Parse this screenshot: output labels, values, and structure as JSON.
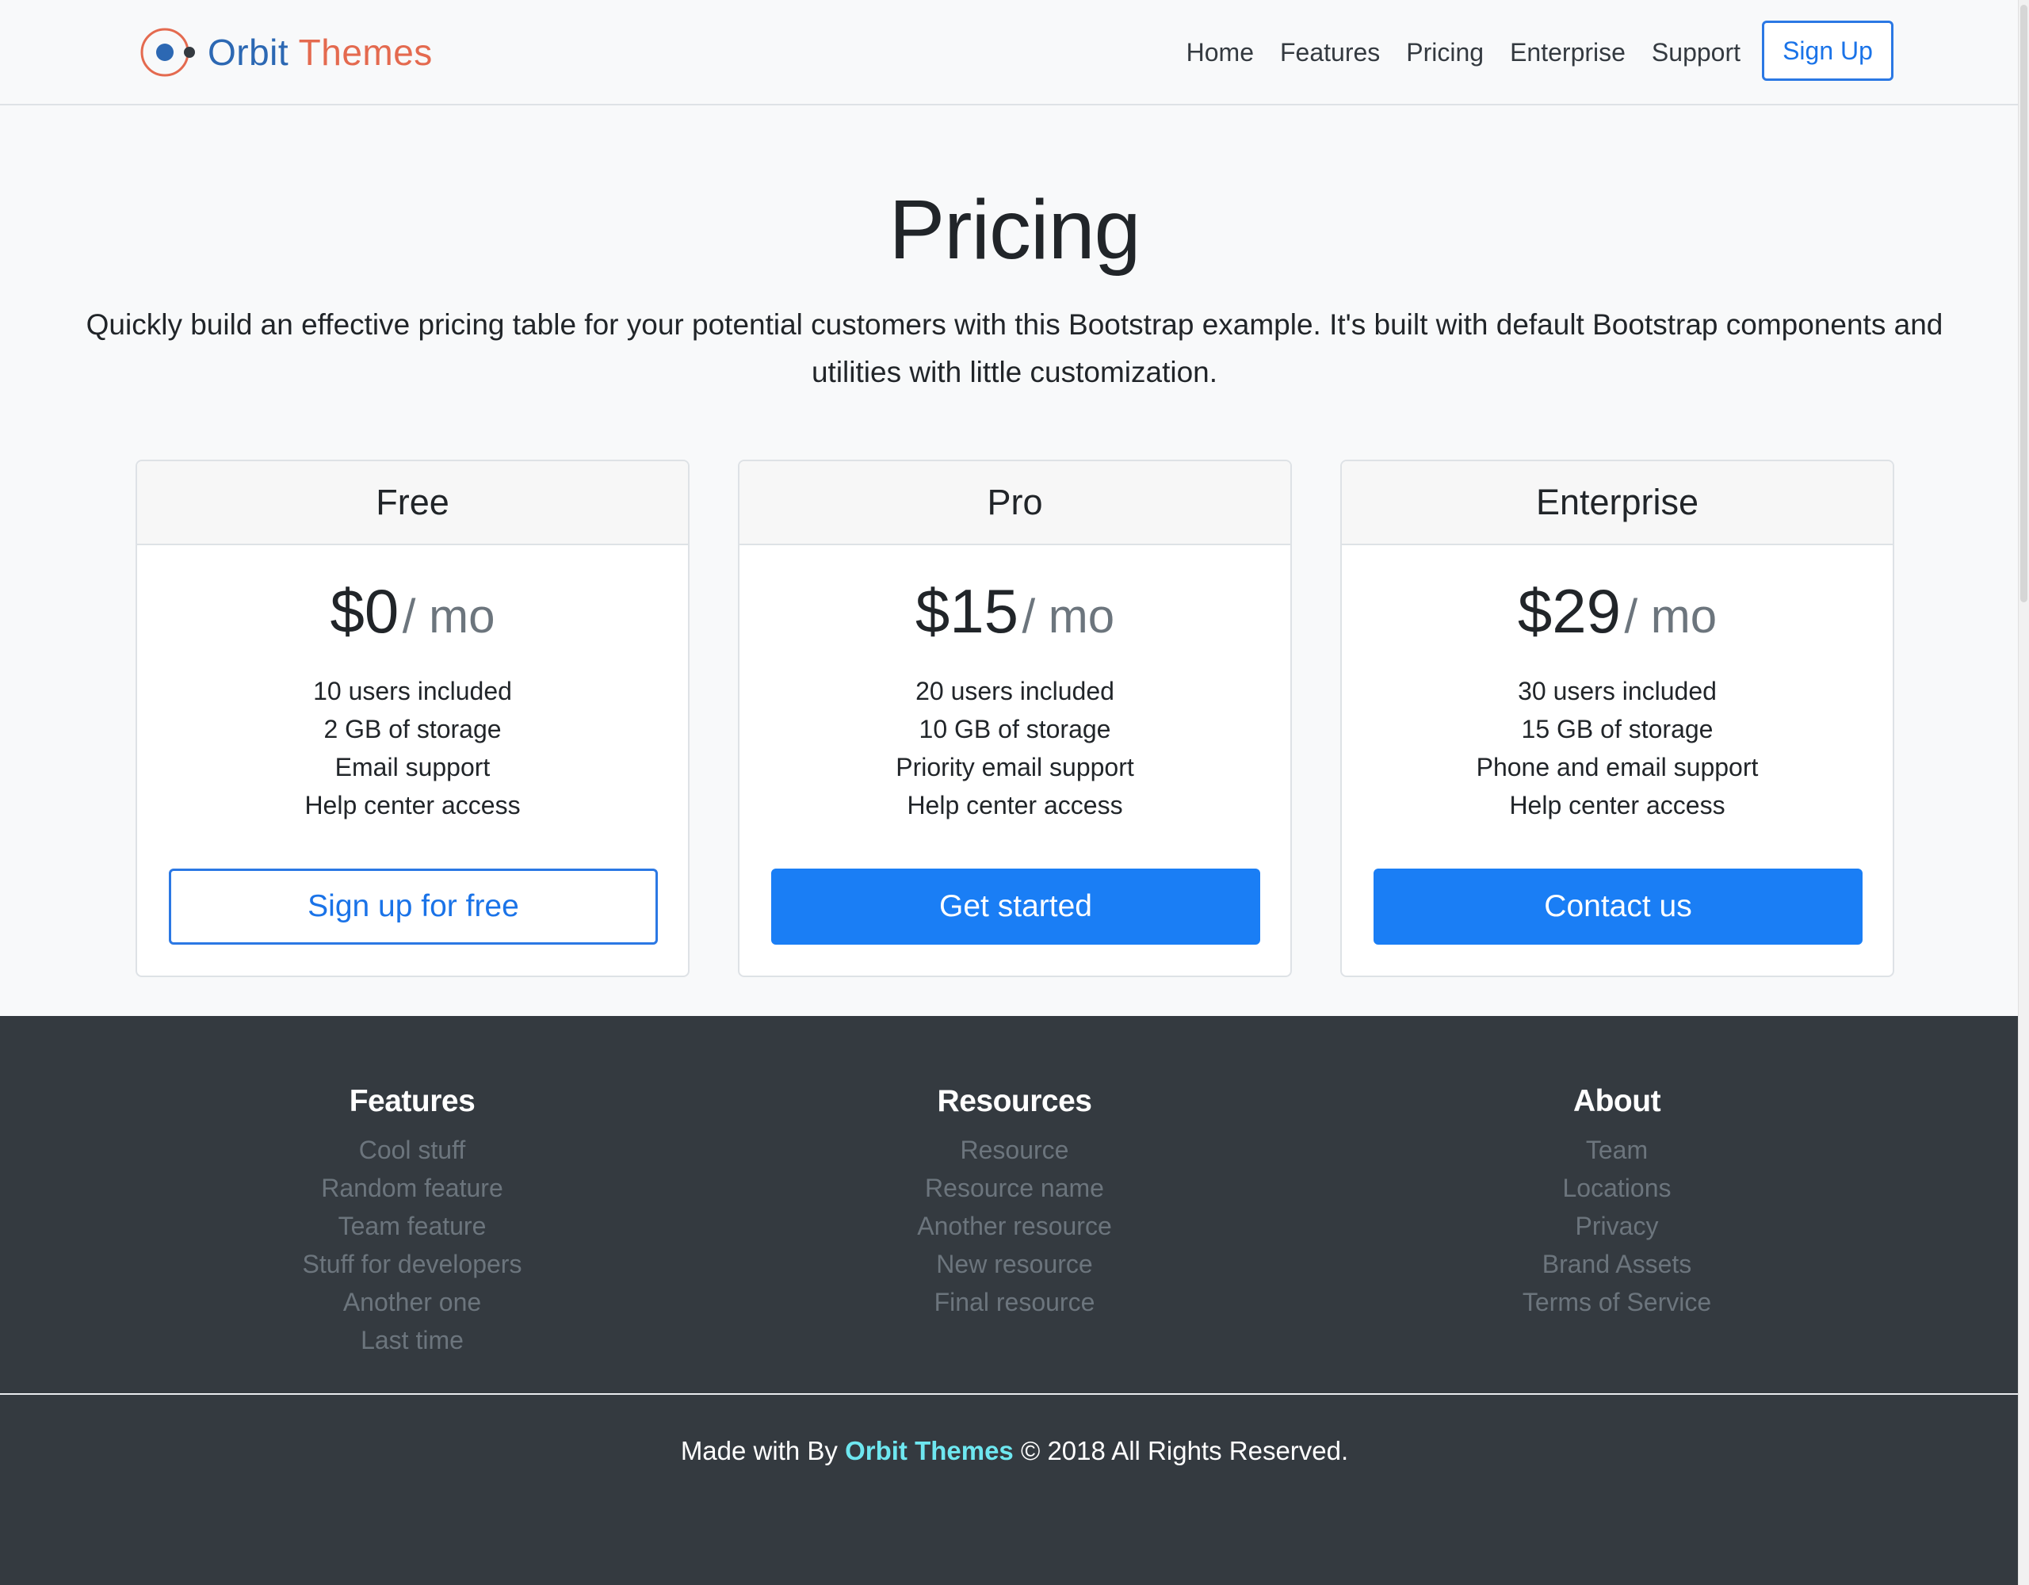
{
  "header": {
    "brand": {
      "word1": "Orbit",
      "word2": "Themes"
    },
    "nav": [
      "Home",
      "Features",
      "Pricing",
      "Enterprise",
      "Support"
    ],
    "signup_label": "Sign Up"
  },
  "hero": {
    "title": "Pricing",
    "lead": "Quickly build an effective pricing table for your potential customers with this Bootstrap example. It's built with default Bootstrap components and utilities with little customization."
  },
  "plans": [
    {
      "name": "Free",
      "price": "$0",
      "period": "/ mo",
      "features": [
        "10 users included",
        "2 GB of storage",
        "Email support",
        "Help center access"
      ],
      "cta": "Sign up for free"
    },
    {
      "name": "Pro",
      "price": "$15",
      "period": "/ mo",
      "features": [
        "20 users included",
        "10 GB of storage",
        "Priority email support",
        "Help center access"
      ],
      "cta": "Get started"
    },
    {
      "name": "Enterprise",
      "price": "$29",
      "period": "/ mo",
      "features": [
        "30 users included",
        "15 GB of storage",
        "Phone and email support",
        "Help center access"
      ],
      "cta": "Contact us"
    }
  ],
  "footer": {
    "columns": [
      {
        "title": "Features",
        "links": [
          "Cool stuff",
          "Random feature",
          "Team feature",
          "Stuff for developers",
          "Another one",
          "Last time"
        ]
      },
      {
        "title": "Resources",
        "links": [
          "Resource",
          "Resource name",
          "Another resource",
          "New resource",
          "Final resource"
        ]
      },
      {
        "title": "About",
        "links": [
          "Team",
          "Locations",
          "Privacy",
          "Brand Assets",
          "Terms of Service"
        ]
      }
    ],
    "copyright": {
      "prefix": "Made with By",
      "brand": "Orbit Themes",
      "suffix": "© 2018 All Rights Reserved."
    }
  },
  "colors": {
    "primary": "#1a7ef5",
    "footer_bg": "#343a40",
    "brand_blue": "#2c68b3",
    "brand_orange": "#e46a4f",
    "copyright_accent": "#6ee7f0"
  }
}
